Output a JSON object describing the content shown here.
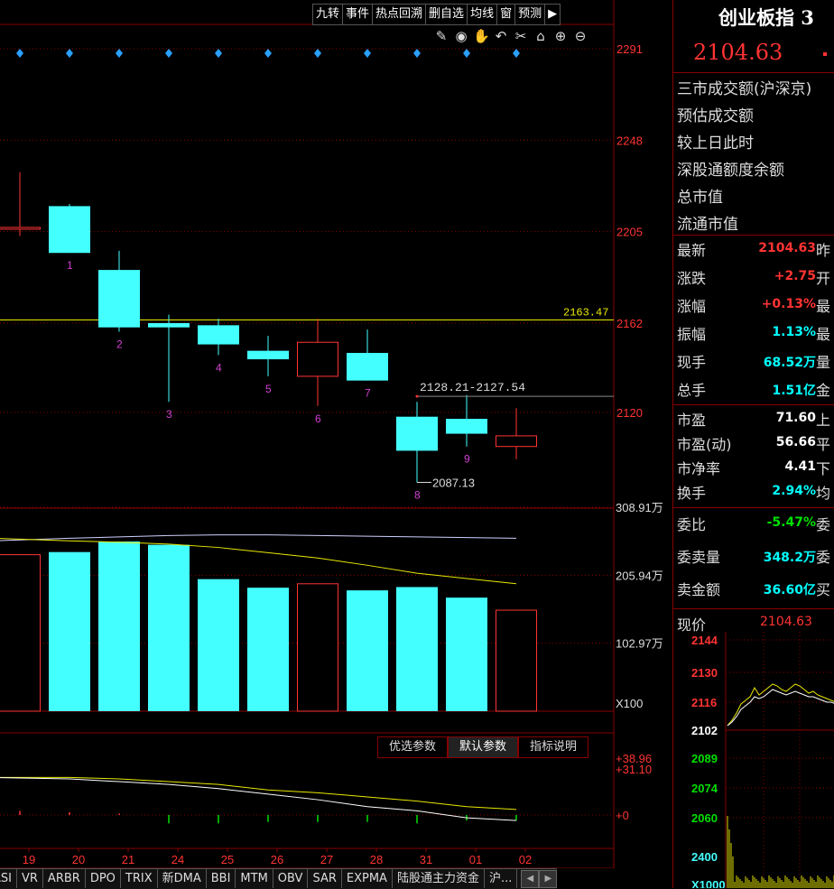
{
  "toolbar": {
    "buttons": [
      "九转",
      "事件",
      "热点回溯",
      "删自选",
      "均线",
      "窗",
      "预测"
    ],
    "pin_icon": "pin-icon"
  },
  "drawing_tools": [
    "pen-icon",
    "eye-icon",
    "hand-icon",
    "undo-icon",
    "scissors-icon",
    "lock-icon",
    "zoom-in-icon",
    "zoom-out-icon"
  ],
  "chart_data": [
    {
      "type": "candlestick",
      "x": [
        "19",
        "20",
        "21",
        "24",
        "25",
        "26",
        "27",
        "28",
        "31",
        "01",
        "02"
      ],
      "ohlc": [
        {
          "label": "",
          "open": 2207,
          "high": 2233,
          "low": 2203,
          "close": 2207,
          "color": "red"
        },
        {
          "label": "1",
          "open": 2217,
          "high": 2218,
          "low": 2195,
          "close": 2195,
          "color": "cyan"
        },
        {
          "label": "2",
          "open": 2187,
          "high": 2196,
          "low": 2158,
          "close": 2160,
          "color": "cyan"
        },
        {
          "label": "3",
          "open": 2162,
          "high": 2166,
          "low": 2125,
          "close": 2160,
          "color": "cyan"
        },
        {
          "label": "4",
          "open": 2161,
          "high": 2164,
          "low": 2147,
          "close": 2152,
          "color": "cyan"
        },
        {
          "label": "5",
          "open": 2149,
          "high": 2156,
          "low": 2137,
          "close": 2145,
          "color": "cyan"
        },
        {
          "label": "6",
          "open": 2137,
          "high": 2164,
          "low": 2123,
          "close": 2153,
          "color": "red"
        },
        {
          "label": "7",
          "open": 2148,
          "high": 2159,
          "low": 2135,
          "close": 2135,
          "color": "cyan"
        },
        {
          "label": "8",
          "open": 2118,
          "high": 2125,
          "low": 2087.13,
          "close": 2102,
          "color": "cyan"
        },
        {
          "label": "9",
          "open": 2117,
          "high": 2128.21,
          "low": 2104,
          "close": 2110,
          "color": "cyan"
        },
        {
          "label": "",
          "open": 2104,
          "high": 2122,
          "low": 2098,
          "close": 2109,
          "color": "red"
        }
      ],
      "y_ticks": [
        2291,
        2248,
        2205,
        2162,
        2120
      ],
      "ylim": [
        2077,
        2303
      ],
      "hline": {
        "value": 2163.47,
        "label": "2163.47"
      },
      "range_annotation": "2128.21-2127.54",
      "low_annotation": "2087.13"
    },
    {
      "type": "bar",
      "x": [
        "19",
        "20",
        "21",
        "24",
        "25",
        "26",
        "27",
        "28",
        "31",
        "01",
        "02"
      ],
      "values": [
        237,
        241,
        257,
        252,
        200,
        187,
        193,
        183,
        188,
        172,
        153
      ],
      "colors": [
        "red",
        "cyan",
        "cyan",
        "cyan",
        "cyan",
        "cyan",
        "red",
        "cyan",
        "cyan",
        "cyan",
        "red"
      ],
      "ma_white": [
        258,
        262,
        264,
        266,
        267,
        267,
        266,
        265,
        264,
        263,
        262
      ],
      "ma_yellow": [
        262,
        258,
        256,
        253,
        248,
        240,
        232,
        221,
        209,
        201,
        193
      ],
      "y_ticks": [
        "308.91万",
        "205.94万",
        "102.97万"
      ],
      "scale_label": "X100"
    },
    {
      "type": "line",
      "x": [
        "19",
        "20",
        "21",
        "24",
        "25",
        "26",
        "27",
        "28",
        "31",
        "01",
        "02"
      ],
      "y_ticks": [
        "+38.96",
        "+31.10",
        "+0"
      ],
      "white_line": [
        27,
        26,
        24,
        22,
        19,
        15,
        11,
        6,
        3,
        -2,
        -4
      ],
      "yellow_line": [
        27,
        27,
        26,
        24,
        22,
        18,
        16,
        13,
        10,
        6,
        4
      ],
      "bars": [
        3,
        2,
        1,
        -6,
        -6,
        -5,
        -5,
        -5,
        -6,
        -4,
        -4
      ]
    }
  ],
  "param_tabs": [
    "优选参数",
    "默认参数",
    "指标说明"
  ],
  "bottom_tabs": [
    "ASI",
    "VR",
    "ARBR",
    "DPO",
    "TRIX",
    "新DMA",
    "BBI",
    "MTM",
    "OBV",
    "SAR",
    "EXPMA",
    "陆股通主力资金",
    "沪..."
  ],
  "right_panel": {
    "title": "创业板指 3",
    "price": "2104.63",
    "info_rows": [
      "三市成交额(沪深京)",
      "预估成交额",
      "较上日此时",
      "深股通额度余额",
      "总市值",
      "流通市值"
    ],
    "stats": [
      {
        "label": "最新",
        "value": "2104.63",
        "color": "red",
        "next": "昨"
      },
      {
        "label": "涨跌",
        "value": "+2.75",
        "color": "red",
        "next": "开"
      },
      {
        "label": "涨幅",
        "value": "+0.13%",
        "color": "red",
        "next": "最"
      },
      {
        "label": "振幅",
        "value": "1.13%",
        "color": "cyan",
        "next": "最"
      },
      {
        "label": "现手",
        "value": "68.52万",
        "color": "cyan",
        "next": "量"
      },
      {
        "label": "总手",
        "value": "1.51亿",
        "color": "cyan",
        "next": "金"
      }
    ],
    "valuation": [
      {
        "label": "市盈",
        "value": "71.60",
        "color": "white",
        "next": "上"
      },
      {
        "label": "市盈(动)",
        "value": "56.66",
        "color": "white",
        "next": "平"
      },
      {
        "label": "市净率",
        "value": "4.41",
        "color": "white",
        "next": "下"
      },
      {
        "label": "换手",
        "value": "2.94%",
        "color": "cyan",
        "next": "均"
      }
    ],
    "orders": [
      {
        "label": "委比",
        "value": "-5.47%",
        "color": "green",
        "next": "委"
      },
      {
        "label": "委卖量",
        "value": "348.2万",
        "color": "cyan",
        "next": "委"
      },
      {
        "label": "卖金额",
        "value": "36.60亿",
        "color": "cyan",
        "next": "买"
      }
    ],
    "current_label": "现价",
    "current_value": "2104.63",
    "mini_y_labels": [
      {
        "text": "2144",
        "color": "red"
      },
      {
        "text": "2130",
        "color": "red"
      },
      {
        "text": "2116",
        "color": "red"
      },
      {
        "text": "2102",
        "color": "white"
      },
      {
        "text": "2089",
        "color": "green"
      },
      {
        "text": "2074",
        "color": "green"
      },
      {
        "text": "2060",
        "color": "green"
      },
      {
        "text": "2400",
        "color": "cyan"
      },
      {
        "text": "X1000",
        "color": "cyan"
      }
    ]
  },
  "colors": {
    "up": "#ff3333",
    "down": "#44ffff",
    "grid": "#880000",
    "ma_yellow": "#e8e800"
  }
}
